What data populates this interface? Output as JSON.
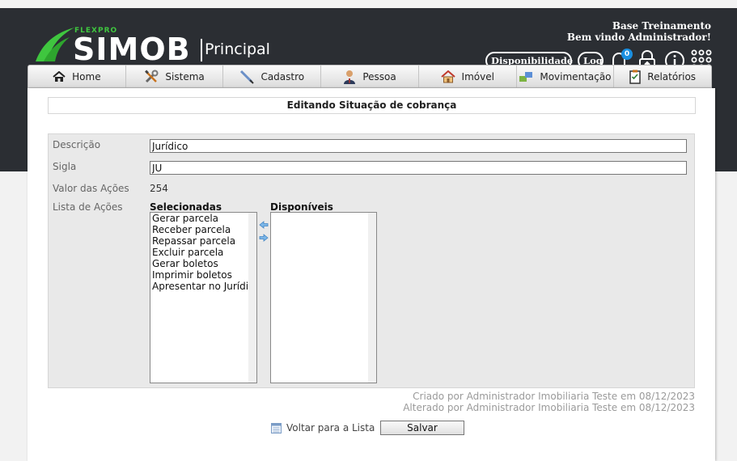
{
  "header": {
    "brand_small": "FLEXPRO",
    "brand": "SIMOB",
    "module": "Principal",
    "company": "Base Treinamento",
    "welcome": "Bem vindo Administrador!",
    "buttons": {
      "availability": "Disponibilidade",
      "log": "Log"
    },
    "notification_count": "0",
    "icons": [
      "bell-icon",
      "lock-icon",
      "info-icon",
      "apps-grid-icon"
    ]
  },
  "nav": [
    {
      "label": "Home",
      "icon": "home-icon"
    },
    {
      "label": "Sistema",
      "icon": "tools-icon"
    },
    {
      "label": "Cadastro",
      "icon": "pen-icon"
    },
    {
      "label": "Pessoa",
      "icon": "person-icon"
    },
    {
      "label": "Imóvel",
      "icon": "house-icon"
    },
    {
      "label": "Movimentação",
      "icon": "transfer-icon"
    },
    {
      "label": "Relatórios",
      "icon": "clipboard-icon"
    }
  ],
  "form": {
    "title": "Editando Situação de cobrança",
    "fields": {
      "descricao": {
        "label": "Descrição",
        "value": "Jurídico"
      },
      "sigla": {
        "label": "Sigla",
        "value": "JU"
      },
      "valor_acoes": {
        "label": "Valor das Ações",
        "value": "254"
      },
      "lista_acoes": {
        "label": "Lista de Ações"
      }
    },
    "selected_header": "Selecionadas",
    "available_header": "Disponíveis",
    "selected_items": [
      "Gerar parcela",
      "Receber parcela",
      "Repassar parcela",
      "Excluir parcela",
      "Gerar boletos",
      "Imprimir boletos",
      "Apresentar no Jurídico"
    ],
    "available_items": [],
    "audit": {
      "created": "Criado por Administrador Imobiliaria Teste em 08/12/2023",
      "modified": "Alterado por Administrador Imobiliaria Teste em 08/12/2023"
    },
    "back_label": "Voltar para a Lista",
    "save_label": "Salvar"
  },
  "colors": {
    "header_bg": "#2b2e33",
    "brand_green": "#3fc63f",
    "badge_blue": "#1a8fe0",
    "form_bg": "#e9e9e9"
  }
}
